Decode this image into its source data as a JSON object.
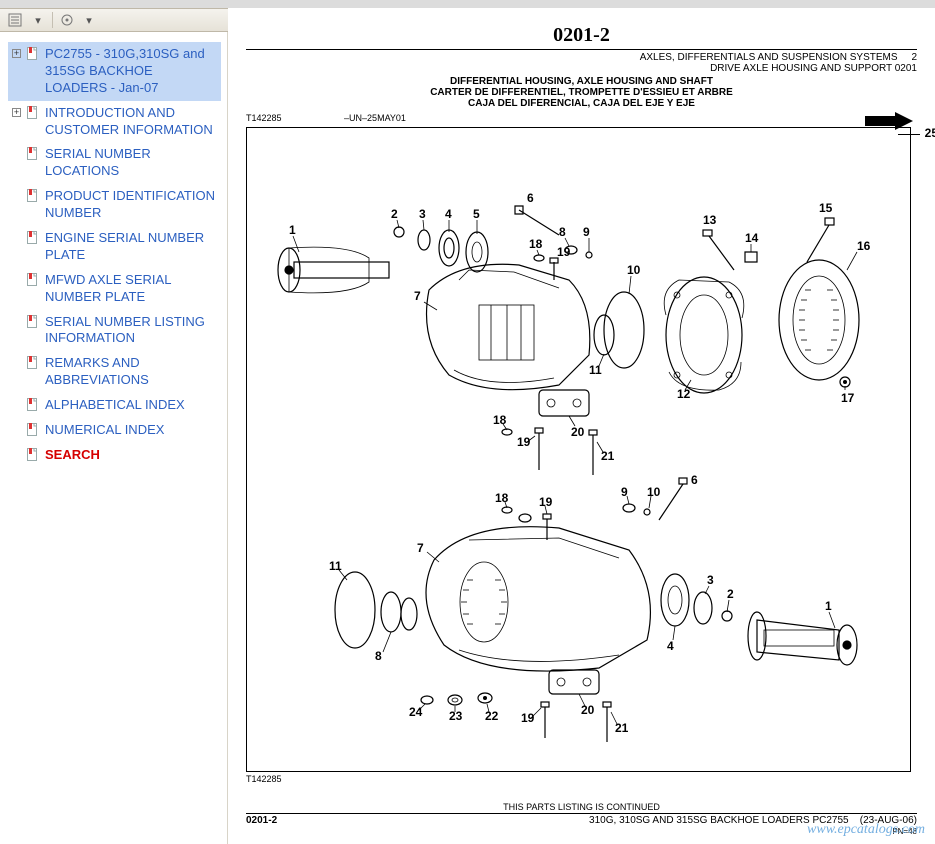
{
  "toolbar": {
    "outline_icon": "outline-icon",
    "collapse_icon": "collapse-icon",
    "options_icon": "options-icon"
  },
  "sidebar": {
    "items": [
      {
        "label": "PC2755 - 310G,310SG and 315SG BACKHOE LOADERS - Jan-07",
        "selected": true,
        "expand": true
      },
      {
        "label": "INTRODUCTION AND CUSTOMER INFORMATION",
        "expand": true
      },
      {
        "label": "SERIAL NUMBER LOCATIONS"
      },
      {
        "label": "PRODUCT IDENTIFICATION NUMBER"
      },
      {
        "label": "ENGINE SERIAL NUMBER PLATE"
      },
      {
        "label": "MFWD AXLE SERIAL NUMBER PLATE"
      },
      {
        "label": "SERIAL NUMBER LISTING INFORMATION"
      },
      {
        "label": "REMARKS AND ABBREVIATIONS"
      },
      {
        "label": "ALPHABETICAL INDEX"
      },
      {
        "label": "NUMERICAL INDEX"
      },
      {
        "label": "SEARCH",
        "search": true
      }
    ]
  },
  "page": {
    "page_number": "0201-2",
    "section_right_1": "AXLES, DIFFERENTIALS AND SUSPENSION SYSTEMS",
    "section_right_num": "2",
    "section_right_2": "DRIVE AXLE HOUSING AND SUPPORT 0201",
    "title_en": "DIFFERENTIAL HOUSING, AXLE HOUSING AND SHAFT",
    "title_fr": "CARTER DE DIFFERENTIEL, TROMPETTE D'ESSIEU ET ARBRE",
    "title_es": "CAJA DEL DIFERENCIAL, CAJA DEL EJE Y EJE",
    "figure_ref_top": "T142285",
    "figure_date": "–UN–25MAY01",
    "callout25": "25",
    "figure_ref_bottom": "T142285",
    "continued": "THIS PARTS LISTING IS CONTINUED",
    "footer_pagenum": "0201-2",
    "footer_machines": "310G, 310SG AND 315SG BACKHOE LOADERS   PC2755",
    "footer_date": "(23-AUG-06)",
    "footer_pn": "PN=48",
    "watermark": "www.epcatalogs.com",
    "diagram_labels": {
      "upper": [
        "1",
        "2",
        "3",
        "4",
        "5",
        "6",
        "7",
        "8",
        "9",
        "10",
        "11",
        "12",
        "13",
        "14",
        "15",
        "16",
        "17",
        "18",
        "19",
        "20",
        "21"
      ],
      "lower": [
        "1",
        "2",
        "3",
        "4",
        "6",
        "7",
        "8",
        "9",
        "10",
        "11",
        "18",
        "19",
        "20",
        "21",
        "22",
        "23",
        "24"
      ]
    }
  }
}
